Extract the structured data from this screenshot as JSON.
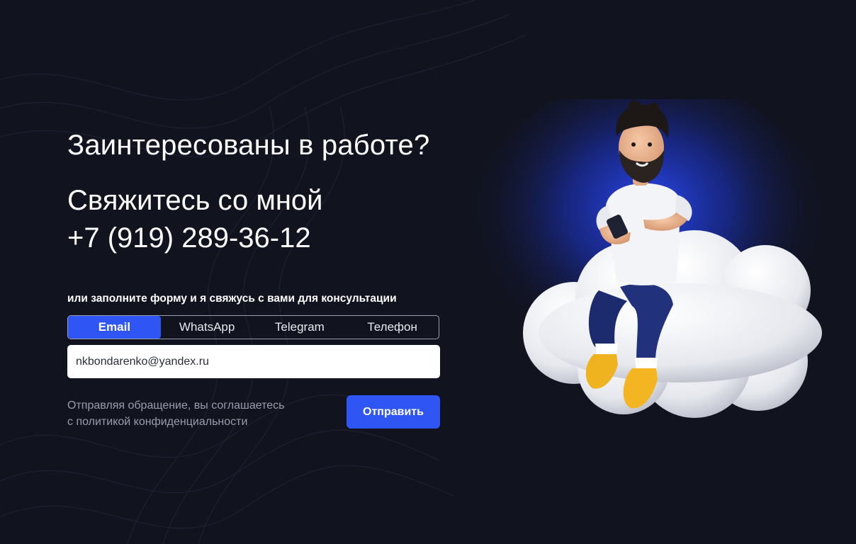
{
  "hero": {
    "headline": "Заинтересованы в работе?",
    "contact_title": "Свяжитесь со мной",
    "phone": "+7 (919) 289-36-12"
  },
  "form": {
    "hint": "или заполните форму и я свяжусь с вами для консультации",
    "tabs": [
      {
        "label": "Email",
        "active": true
      },
      {
        "label": "WhatsApp",
        "active": false
      },
      {
        "label": "Telegram",
        "active": false
      },
      {
        "label": "Телефон",
        "active": false
      }
    ],
    "email_value": "nkbondarenko@yandex.ru",
    "policy_line1": "Отправляя обращение, вы соглашаетесь",
    "policy_line2": "с политикой конфиденциальности",
    "submit_label": "Отправить"
  },
  "colors": {
    "background": "#11131f",
    "accent": "#2f55f4",
    "muted_text": "#9a9cac"
  }
}
